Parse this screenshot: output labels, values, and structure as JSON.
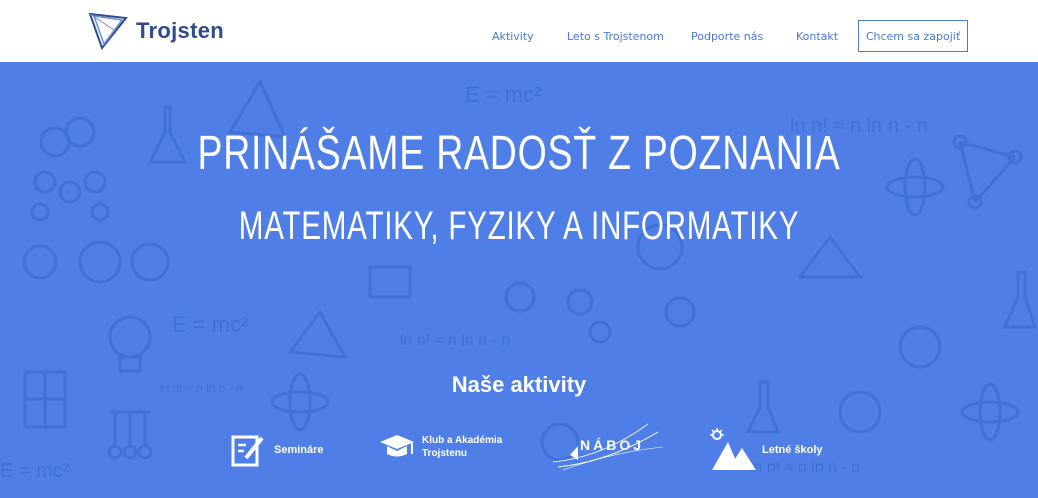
{
  "header": {
    "logo_text": "Trojsten",
    "nav": [
      "Aktivity",
      "Leto s Trojstenom",
      "Podporte nás",
      "Kontakt"
    ],
    "cta_label": "Chcem sa zapojiť"
  },
  "hero": {
    "headline_line1": "PRINÁŠAME RADOSŤ Z POZNANIA",
    "headline_line2": "MATEMATIKY, FYZIKY A INFORMATIKY",
    "section_title": "Naše aktivity",
    "doodle_texts": [
      "E = mc²",
      "ln n! ≈ n ln n - n",
      "E = mc²",
      "ln n! ≈ n ln n - n",
      "ln n! ≈ n ln n - n",
      "E = mc²",
      "ln n! ≈ n ln n - n"
    ]
  },
  "activities": [
    {
      "label_line1": "Semináre",
      "label_line2": "",
      "icon": "seminar-icon"
    },
    {
      "label_line1": "Klub a Akadémia",
      "label_line2": "Trojstenu",
      "icon": "graduation-cap-icon"
    },
    {
      "label_line1": "NÁBOJ",
      "label_line2": "",
      "icon": "naboj-logo"
    },
    {
      "label_line1": "Letné školy",
      "label_line2": "",
      "icon": "mountains-icon"
    }
  ],
  "colors": {
    "primary": "#4f7fe6",
    "accent": "#4a78d8",
    "logo": "#2f4b8c"
  }
}
